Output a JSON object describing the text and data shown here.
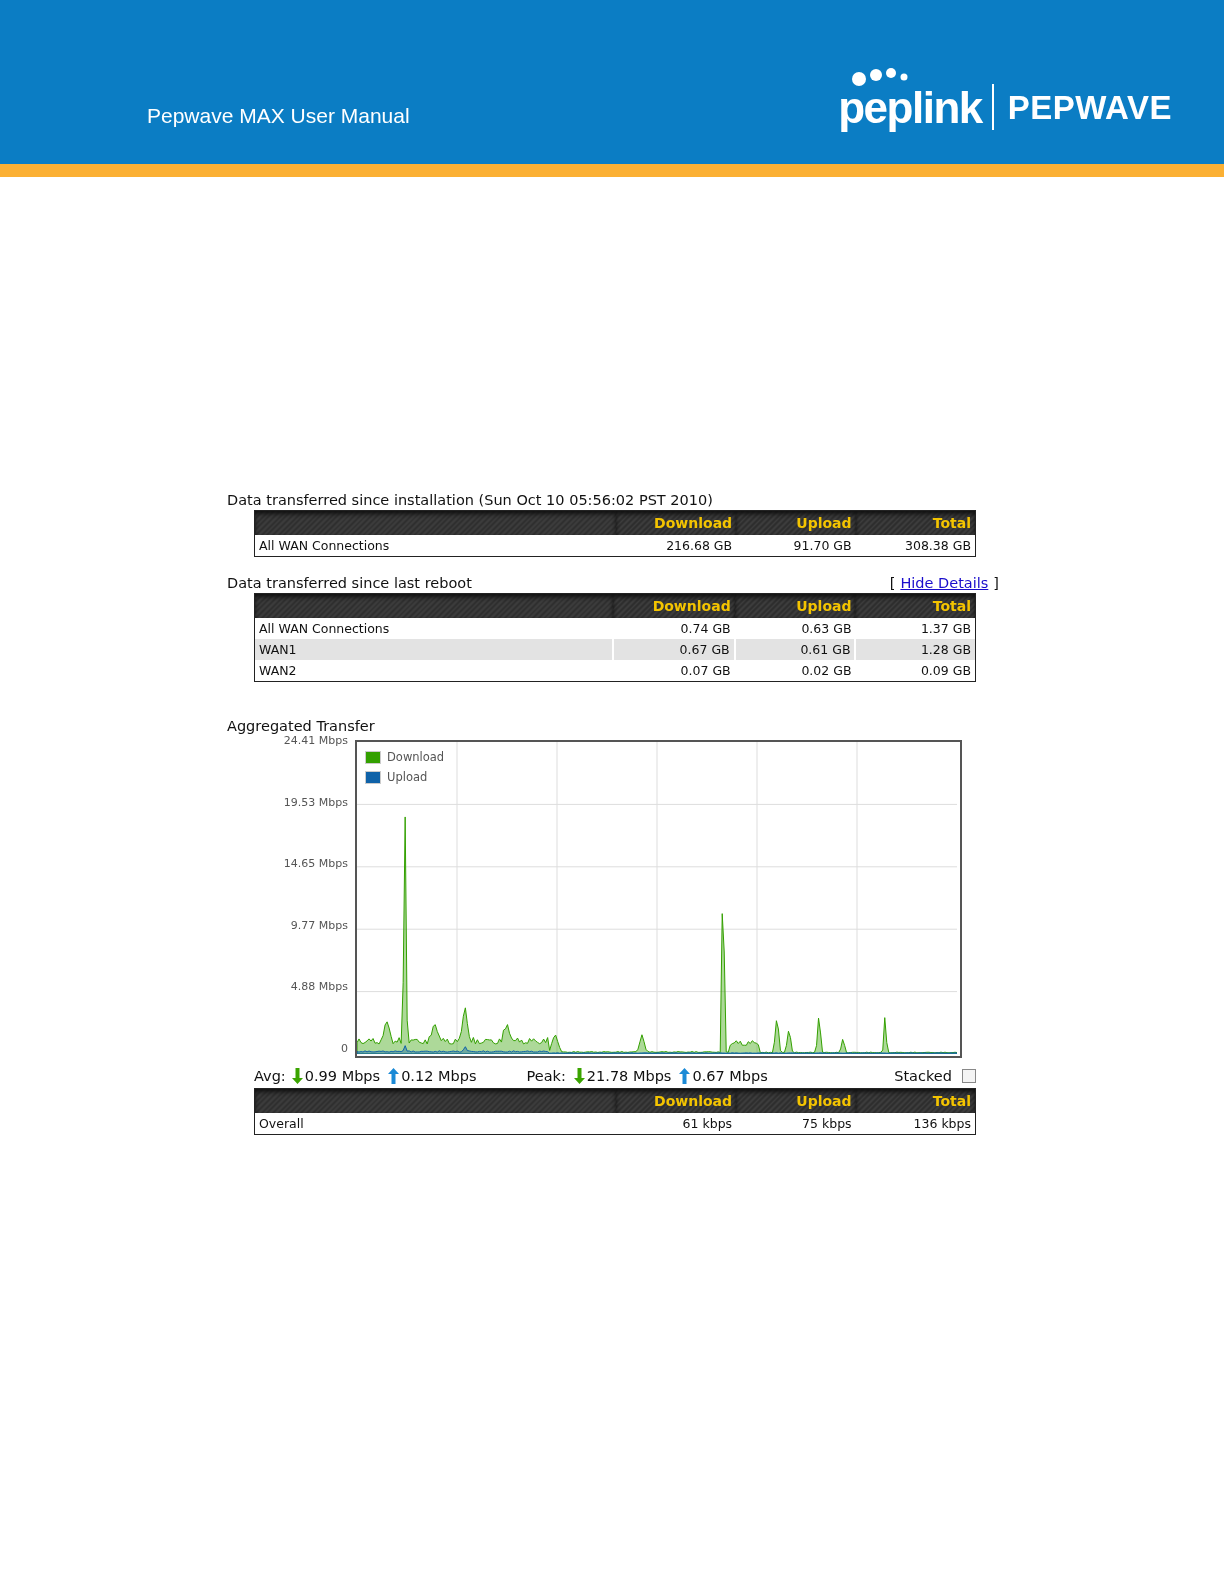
{
  "header": {
    "title": "Pepwave MAX User Manual",
    "logo_left": "peplink",
    "logo_right": "PEPWAVE"
  },
  "install_section": {
    "title": "Data transferred since installation (Sun Oct 10 05:56:02 PST 2010)",
    "columns": [
      "Download",
      "Upload",
      "Total"
    ],
    "rows": [
      {
        "name": "All WAN Connections",
        "download": "216.68 GB",
        "upload": "91.70 GB",
        "total": "308.38 GB",
        "highlighted": false
      }
    ]
  },
  "reboot_section": {
    "title": "Data transferred since last reboot",
    "link_open": "[",
    "link": "Hide Details",
    "link_close": "]",
    "columns": [
      "Download",
      "Upload",
      "Total"
    ],
    "rows": [
      {
        "name": "All WAN Connections",
        "download": "0.74 GB",
        "upload": "0.63 GB",
        "total": "1.37 GB",
        "highlighted": false
      },
      {
        "name": "WAN1",
        "download": "0.67 GB",
        "upload": "0.61 GB",
        "total": "1.28 GB",
        "highlighted": true
      },
      {
        "name": "WAN2",
        "download": "0.07 GB",
        "upload": "0.02 GB",
        "total": "0.09 GB",
        "highlighted": false
      }
    ]
  },
  "graph": {
    "title": "Aggregated Transfer",
    "y_labels": [
      "24.41 Mbps",
      "19.53 Mbps",
      "14.65 Mbps",
      "9.77 Mbps",
      "4.88 Mbps",
      "0"
    ],
    "legend": [
      {
        "label": "Download",
        "color": "#33a000"
      },
      {
        "label": "Upload",
        "color": "#0f62a8"
      }
    ]
  },
  "stats": {
    "avg_label": "Avg:",
    "avg_download": "0.99 Mbps",
    "avg_upload": "0.12 Mbps",
    "peak_label": "Peak:",
    "peak_download": "21.78 Mbps",
    "peak_upload": "0.67 Mbps",
    "stacked_label": "Stacked",
    "stacked_checked": false
  },
  "overall_section": {
    "columns": [
      "Download",
      "Upload",
      "Total"
    ],
    "rows": [
      {
        "name": "Overall",
        "download": "61 kbps",
        "upload": "75 kbps",
        "total": "136 kbps",
        "highlighted": false
      }
    ]
  }
}
